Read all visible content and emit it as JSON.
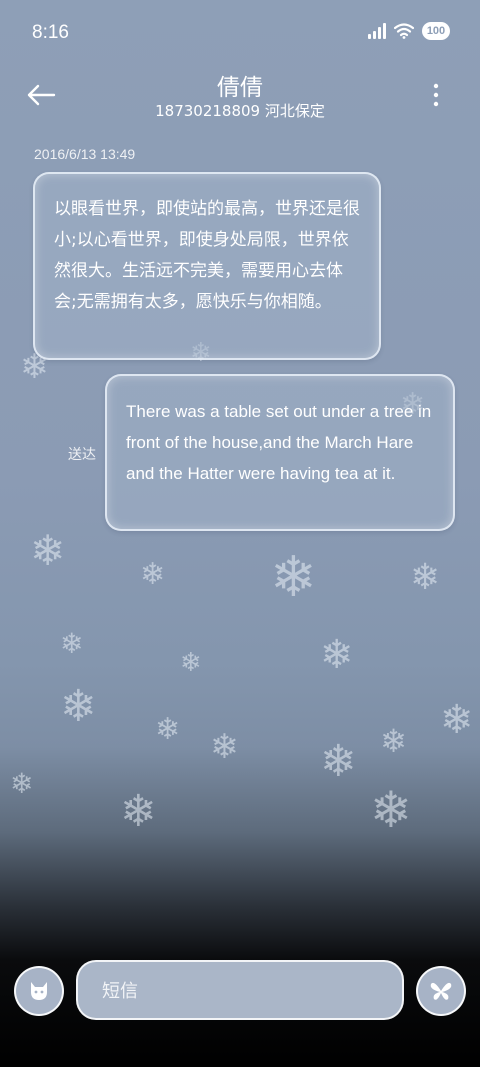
{
  "status_bar": {
    "time": "8:16",
    "battery_level": "100",
    "icons": [
      "signal-icon",
      "wifi-icon",
      "battery-icon"
    ]
  },
  "header": {
    "title": "倩倩",
    "subtitle": "18730218809 河北保定",
    "icons": [
      "back-arrow-icon",
      "more-vert-icon"
    ]
  },
  "conversation": {
    "timestamp": "2016/6/13 13:49",
    "messages": [
      {
        "direction": "incoming",
        "text": "以眼看世界，即使站的最高，世界还是很小;以心看世界，即使身处局限，世界依然很大。生活远不完美，需要用心去体会;无需拥有太多，愿快乐与你相随。"
      },
      {
        "direction": "outgoing",
        "status": "送达",
        "text": "There was a table set out under a tree in front of the house,and the March Hare and the Hatter were having tea at it."
      }
    ]
  },
  "composer": {
    "placeholder": "短信",
    "icons": [
      "cat-avatar-icon",
      "butterfly-send-icon"
    ]
  },
  "colors": {
    "background_top": "#8e9fb7",
    "background_bottom": "#000000",
    "bubble_fill": "#a0b0c6",
    "bubble_border": "#ebf2fa",
    "text": "#ffffff"
  }
}
